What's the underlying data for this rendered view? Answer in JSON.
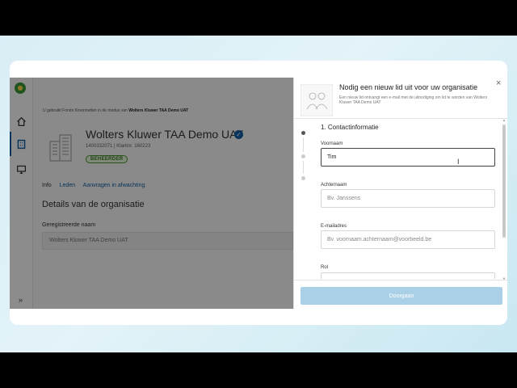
{
  "app": {
    "breadcrumb_prefix": "U gebruikt Fonds Kroonnetten in de modus van",
    "breadcrumb_org": "Wolters Kluwer TAA Demo UAT",
    "org_title": "Wolters Kluwer TAA Demo UAT",
    "org_sub": "1400332071 | Klantnr. 160223",
    "role_badge": "BEHEERDER",
    "tabs": [
      {
        "label": "Info"
      },
      {
        "label": "Leden"
      },
      {
        "label": "Aanvragen in afwachting"
      }
    ],
    "section_title": "Details van de organisatie",
    "field_label": "Geregistreerde naam",
    "field_value": "Wolters Kluwer TAA Demo UAT",
    "collapse_label": "»"
  },
  "drawer": {
    "title": "Nodig een nieuw lid uit voor uw organisatie",
    "description": "Een nieuw lid ontvangt een e-mail met de uitnodiging om lid te worden van Wolters Kluwer TAA Demo UAT",
    "close_label": "×",
    "step_title": "1. Contactinformatie",
    "fields": {
      "first_name_label": "Voornaam",
      "first_name_value": "Tim",
      "last_name_label": "Achternaam",
      "last_name_placeholder": "Bv. Janssens",
      "email_label": "E-mailadres",
      "email_placeholder": "Bv. voornaam.achternaam@voorbeeld.be",
      "role_label": "Rol"
    },
    "submit_label": "Doorgaan"
  },
  "colors": {
    "accent": "#0f5fa8",
    "badge_green": "#4a9a2a",
    "submit_disabled": "#a9d0e7"
  },
  "icons": [
    "home-icon",
    "building-icon",
    "monitor-icon",
    "close-icon",
    "text-cursor-icon",
    "verified-icon"
  ]
}
